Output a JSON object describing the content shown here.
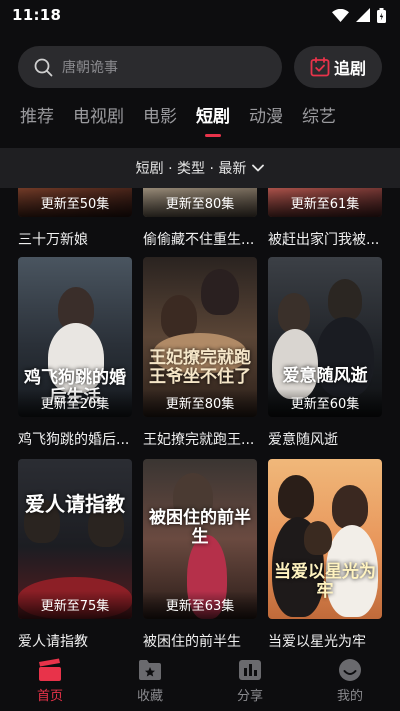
{
  "status": {
    "time": "11:18"
  },
  "search": {
    "placeholder": "唐朝诡事",
    "drama_button_label": "追剧"
  },
  "tabs": [
    {
      "label": "推荐",
      "active": false
    },
    {
      "label": "电视剧",
      "active": false
    },
    {
      "label": "电影",
      "active": false
    },
    {
      "label": "短剧",
      "active": true
    },
    {
      "label": "动漫",
      "active": false
    },
    {
      "label": "综艺",
      "active": false
    }
  ],
  "filter": {
    "text": "短剧 · 类型 · 最新"
  },
  "rows": [
    [
      {
        "title": "三十万新娘",
        "episode": "更新至50集"
      },
      {
        "title": "偷偷藏不住重生...",
        "episode": "更新至80集"
      },
      {
        "title": "被赶出家门我被...",
        "episode": "更新至61集"
      }
    ],
    [
      {
        "title": "鸡飞狗跳的婚后...",
        "episode": "更新至20集",
        "art_text": "鸡飞狗跳的婚后生活"
      },
      {
        "title": "王妃撩完就跑王...",
        "episode": "更新至80集",
        "art_text": "王妃撩完就跑王爷坐不住了"
      },
      {
        "title": "爱意随风逝",
        "episode": "更新至60集",
        "art_text": "爱意随风逝"
      }
    ],
    [
      {
        "title": "爱人请指教",
        "episode": "更新至75集",
        "art_text": "爱人请指教"
      },
      {
        "title": "被困住的前半生",
        "episode": "更新至63集",
        "art_text": "被困住的前半生"
      },
      {
        "title": "当爱以星光为牢",
        "episode": "",
        "art_text": "当爱以星光为牢"
      }
    ]
  ],
  "bottom_nav": [
    {
      "label": "首页",
      "icon": "clapperboard-icon",
      "active": true
    },
    {
      "label": "收藏",
      "icon": "favorite-folder-icon",
      "active": false
    },
    {
      "label": "分享",
      "icon": "bar-chart-icon",
      "active": false
    },
    {
      "label": "我的",
      "icon": "profile-icon",
      "active": false
    }
  ],
  "colors": {
    "accent": "#e8334a",
    "background": "#0d0d0f",
    "surface": "#2b2b2e"
  }
}
